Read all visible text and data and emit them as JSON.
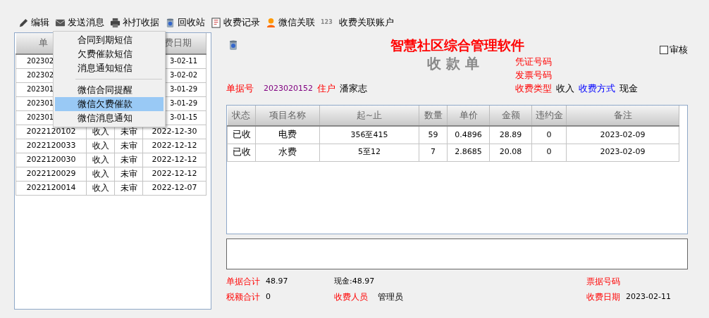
{
  "toolbar": [
    {
      "label": "编辑"
    },
    {
      "label": "发送消息"
    },
    {
      "label": "补打收据"
    },
    {
      "label": "回收站"
    },
    {
      "label": "收费记录"
    },
    {
      "label": "微信关联"
    },
    {
      "label": "收费关联账户",
      "icon_text": "123"
    }
  ],
  "list": {
    "columns": {
      "number": "单",
      "date": "费日期"
    },
    "rows": [
      {
        "number": "202302",
        "date": "3-02-11"
      },
      {
        "number": "202302",
        "date": "3-02-02"
      },
      {
        "number": "202301",
        "date": "3-01-29"
      },
      {
        "number": "202301",
        "date": "3-01-29"
      },
      {
        "number": "202301",
        "date": "3-01-15"
      },
      {
        "number": "2022120102",
        "column_2": "收入",
        "column_3": "未审",
        "date": "2022-12-30"
      },
      {
        "number": "2022120033",
        "column_2": "收入",
        "column_3": "未审",
        "date": "2022-12-12"
      },
      {
        "number": "2022120030",
        "column_2": "收入",
        "column_3": "未审",
        "date": "2022-12-12"
      },
      {
        "number": "2022120029",
        "column_2": "收入",
        "column_3": "未审",
        "date": "2022-12-12"
      },
      {
        "number": "2022120014",
        "column_2": "收入",
        "column_3": "未审",
        "date": "2022-12-07"
      }
    ]
  },
  "menu": {
    "groups": [
      [
        {
          "label": "合同到期短信",
          "selected": false
        },
        {
          "label": "欠费催款短信",
          "selected": false
        },
        {
          "label": "消息通知短信",
          "selected": false
        }
      ],
      [
        {
          "label": "微信合同提醒",
          "selected": false
        },
        {
          "label": "微信欠费催款",
          "selected": true
        },
        {
          "label": "微信消息通知",
          "selected": false
        }
      ]
    ]
  },
  "receipt": {
    "software_title": "智慧社区综合管理软件",
    "title": "收 款 单",
    "audit": {
      "label": "审核",
      "checked": false
    },
    "voucher_label": "凭证号码",
    "invoice_label": "发票号码",
    "number_label": "单据号",
    "number": "2023020152",
    "resident_label": "住户",
    "resident": "潘家志",
    "fee_type_label": "收费类型",
    "fee_type": "收入",
    "pay_method_label": "收费方式",
    "pay_method": "现金",
    "table": {
      "columns": [
        "状态",
        "项目名称",
        "起~止",
        "数量",
        "单价",
        "金额",
        "违约金",
        "备注"
      ],
      "rows": [
        [
          "已收",
          "电费",
          "356至415",
          "59",
          "0.4896",
          "28.89",
          "0",
          "2023-02-09"
        ],
        [
          "已收",
          "水费",
          "5至12",
          "7",
          "2.8685",
          "20.08",
          "0",
          "2023-02-09"
        ]
      ]
    },
    "total_label": "单据合计",
    "total": "48.97",
    "cash": "现金:48.97",
    "ticket_label": "票据号码",
    "tax_label": "税额合计",
    "tax": "0",
    "cashier_label": "收费人员",
    "cashier": "管理员",
    "date_label": "收费日期",
    "date": "2023-02-11"
  }
}
